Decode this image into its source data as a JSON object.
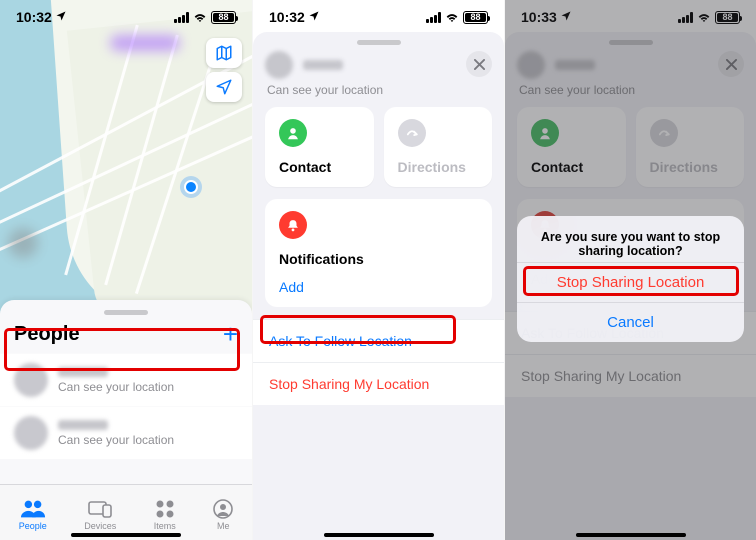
{
  "status": {
    "time_a": "10:32",
    "time_b": "10:32",
    "time_c": "10:33",
    "battery": "88"
  },
  "screen1": {
    "sheet_title": "People",
    "row_sub": "Can see your location",
    "tabs": {
      "people": "People",
      "devices": "Devices",
      "items": "Items",
      "me": "Me"
    }
  },
  "screen2": {
    "subhead": "Can see your location",
    "card_contact": "Contact",
    "card_directions": "Directions",
    "notifications": "Notifications",
    "add": "Add",
    "ask_follow": "Ask To Follow Location",
    "stop_share": "Stop Sharing My Location"
  },
  "screen3": {
    "dialog_title": "Are you sure you want to stop sharing location?",
    "dialog_stop": "Stop Sharing Location",
    "dialog_cancel": "Cancel",
    "stop_share_grey": "Stop Sharing My Location"
  }
}
